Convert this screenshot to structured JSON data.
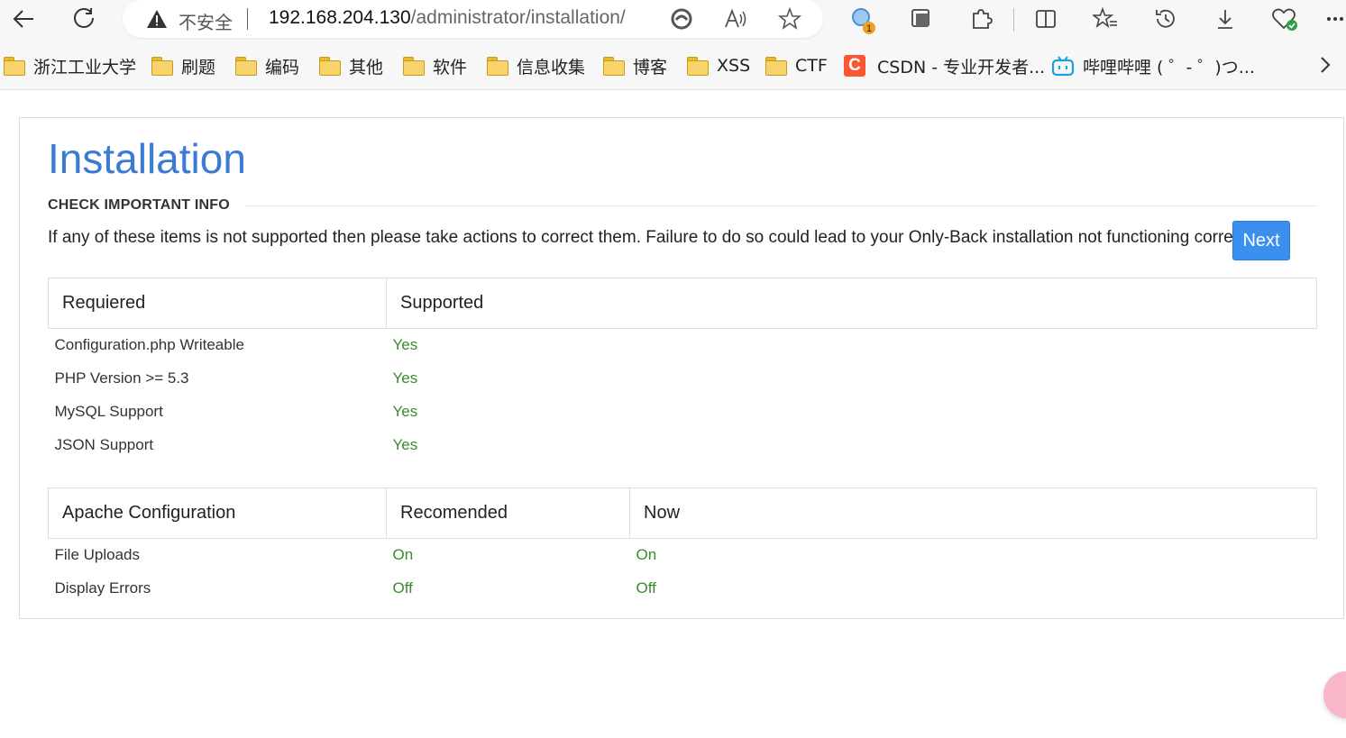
{
  "browser": {
    "insecure_label": "不安全",
    "url_host": "192.168.204.130",
    "url_path": "/administrator/installation/",
    "extension_badge": "1"
  },
  "bookmarks": [
    {
      "label": "浙江工业大学",
      "icon": "folder-icon"
    },
    {
      "label": "刷题",
      "icon": "folder-icon"
    },
    {
      "label": "编码",
      "icon": "folder-icon"
    },
    {
      "label": "其他",
      "icon": "folder-icon"
    },
    {
      "label": "软件",
      "icon": "folder-icon"
    },
    {
      "label": "信息收集",
      "icon": "folder-icon"
    },
    {
      "label": "博客",
      "icon": "folder-icon"
    },
    {
      "label": "XSS",
      "icon": "folder-icon"
    },
    {
      "label": "CTF",
      "icon": "folder-icon"
    },
    {
      "label": "CSDN - 专业开发者...",
      "icon": "csdn-icon"
    },
    {
      "label": "哔哩哔哩 ( ゜- ゜)つ...",
      "icon": "bilibili-icon"
    }
  ],
  "page": {
    "title": "Installation",
    "section_heading": "CHECK IMPORTANT INFO",
    "info_text": "If any of these items is not supported then please take actions to correct them. Failure to do so could lead to your Only-Back installation not functioning correctly.",
    "next_button": "Next",
    "requirements_table": {
      "headers": [
        "Requiered",
        "Supported"
      ],
      "rows": [
        [
          "Configuration.php Writeable",
          "Yes"
        ],
        [
          "PHP Version >= 5.3",
          "Yes"
        ],
        [
          "MySQL Support",
          "Yes"
        ],
        [
          "JSON Support",
          "Yes"
        ]
      ]
    },
    "apache_table": {
      "headers": [
        "Apache Configuration",
        "Recomended",
        "Now"
      ],
      "rows": [
        [
          "File Uploads",
          "On",
          "On"
        ],
        [
          "Display Errors",
          "Off",
          "Off"
        ]
      ]
    }
  },
  "colors": {
    "title_blue": "#3a7bd5",
    "button_blue": "#3a8fef",
    "ok_green": "#3c8a2e"
  }
}
